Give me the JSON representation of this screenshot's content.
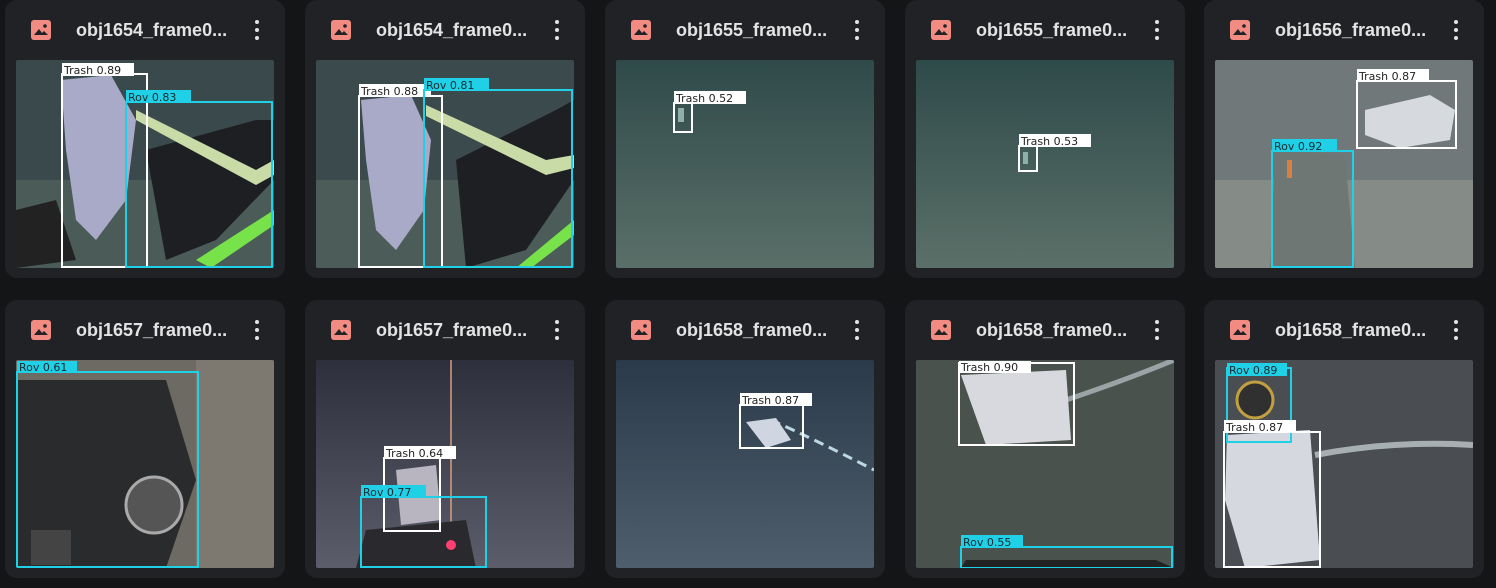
{
  "grid": {
    "items": [
      {
        "title": "obj1654_frame0...",
        "detections": [
          {
            "label": "Trash",
            "score": "0.89"
          },
          {
            "label": "Rov",
            "score": "0.83"
          }
        ]
      },
      {
        "title": "obj1654_frame0...",
        "detections": [
          {
            "label": "Trash",
            "score": "0.88"
          },
          {
            "label": "Rov",
            "score": "0.81"
          }
        ]
      },
      {
        "title": "obj1655_frame0...",
        "detections": [
          {
            "label": "Trash",
            "score": "0.52"
          }
        ]
      },
      {
        "title": "obj1655_frame0...",
        "detections": [
          {
            "label": "Trash",
            "score": "0.53"
          }
        ]
      },
      {
        "title": "obj1656_frame0...",
        "detections": [
          {
            "label": "Trash",
            "score": "0.87"
          },
          {
            "label": "Rov",
            "score": "0.92"
          }
        ]
      },
      {
        "title": "obj1657_frame0...",
        "detections": [
          {
            "label": "Rov",
            "score": "0.61"
          }
        ]
      },
      {
        "title": "obj1657_frame0...",
        "detections": [
          {
            "label": "Trash",
            "score": "0.64"
          },
          {
            "label": "Rov",
            "score": "0.77"
          }
        ]
      },
      {
        "title": "obj1658_frame0...",
        "detections": [
          {
            "label": "Trash",
            "score": "0.87"
          }
        ]
      },
      {
        "title": "obj1658_frame0...",
        "detections": [
          {
            "label": "Trash",
            "score": "0.90"
          },
          {
            "label": "Rov",
            "score": "0.55"
          }
        ]
      },
      {
        "title": "obj1658_frame0...",
        "detections": [
          {
            "label": "Rov",
            "score": "0.89"
          },
          {
            "label": "Trash",
            "score": "0.87"
          }
        ]
      }
    ]
  },
  "icons": {
    "file": "image-file-icon",
    "menu": "more-vert-icon"
  },
  "colors": {
    "page_bg": "#141517",
    "card_bg": "#212226",
    "file_icon": "#f28b82",
    "trash_box": "#ffffff",
    "rov_box": "#1fd0e6"
  }
}
